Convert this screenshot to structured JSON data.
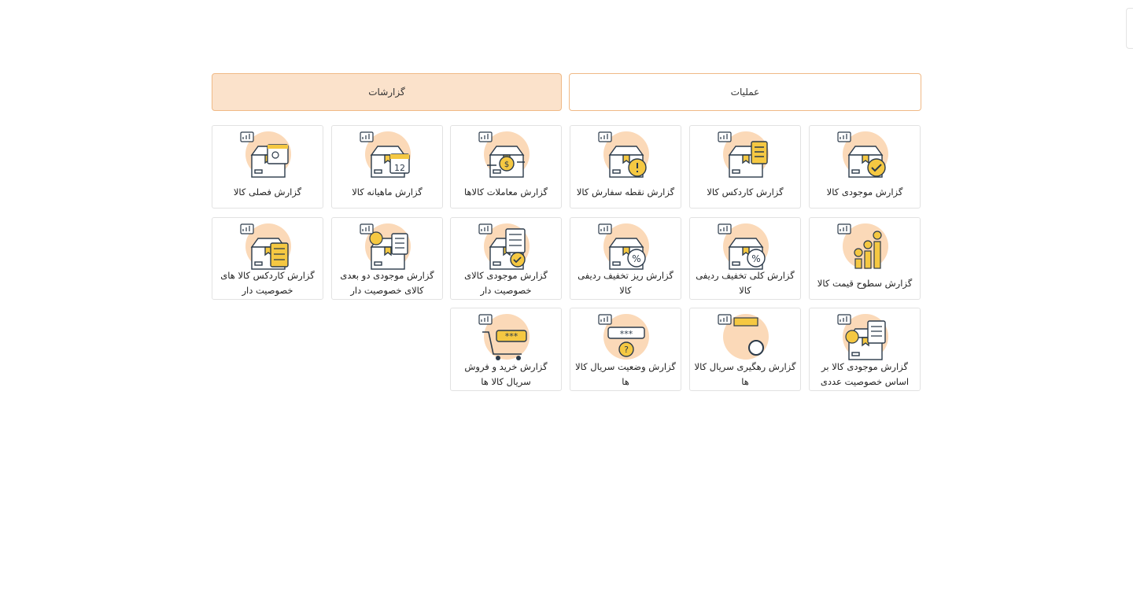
{
  "tabs": {
    "operations": "عملیات",
    "reports": "گزارشات"
  },
  "cards": [
    {
      "label": "گزارش موجودی کالا",
      "icon": "box-check-icon"
    },
    {
      "label": "گزارش کاردکس کالا",
      "icon": "box-clipboard-icon"
    },
    {
      "label": "گزارش نقطه سفارش کالا",
      "icon": "box-alert-icon"
    },
    {
      "label": "گزارش معاملات کالاها",
      "icon": "box-exchange-icon"
    },
    {
      "label": "گزارش ماهیانه کالا",
      "icon": "box-calendar-icon"
    },
    {
      "label": "گزارش فصلی کالا",
      "icon": "box-season-calendar-icon"
    },
    {
      "label": "گزارش سطوح قیمت کالا",
      "icon": "price-levels-icon"
    },
    {
      "label": "گزارش کلی تخفیف ردیفی کالا",
      "icon": "box-discount-icon"
    },
    {
      "label": "گزارش ریز تخفیف ردیفی کالا",
      "icon": "box-discount-detail-icon"
    },
    {
      "label": "گزارش موجودی کالای خصوصیت دار",
      "icon": "box-checklist-icon"
    },
    {
      "label": "گزارش موجودی دو بعدی کالای خصوصیت دار",
      "icon": "box-2d-check-icon"
    },
    {
      "label": "گزارش کاردکس کالا های خصوصیت دار",
      "icon": "box-list-icon"
    },
    {
      "label": "گزارش موجودی کالا بر اساس خصوصیت عددی",
      "icon": "box-numeric-icon"
    },
    {
      "label": "گزارش رهگیری سریال کالا ها",
      "icon": "serial-search-icon"
    },
    {
      "label": "گزارش وضعیت سریال کالا ها",
      "icon": "serial-status-icon"
    },
    {
      "label": "گزارش خرید و فروش سریال کالا ها",
      "icon": "serial-cart-icon"
    }
  ],
  "colors": {
    "accent_border": "#f0b986",
    "active_tab_bg": "#fbe2cb",
    "icon_circle": "#fbd9b8",
    "icon_yellow": "#f5c842",
    "icon_line": "#2b3a4a"
  }
}
